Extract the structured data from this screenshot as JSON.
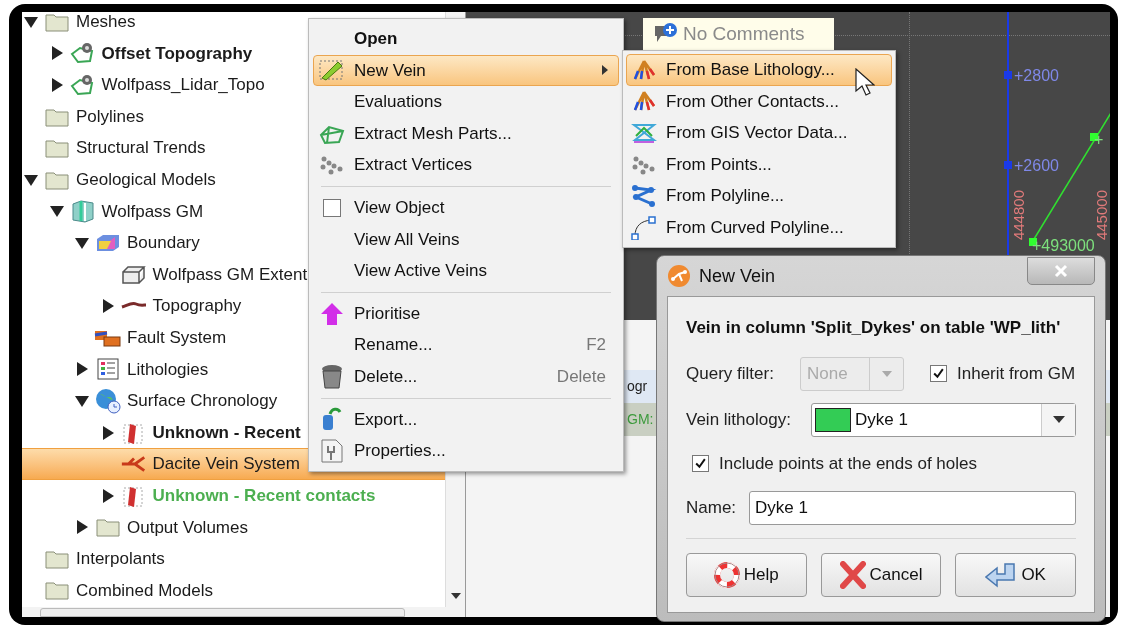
{
  "tree": [
    {
      "label": "Meshes",
      "kind": "folder",
      "expanded": true,
      "selected": false,
      "children": [
        {
          "label": "Offset Topography",
          "kind": "mesh",
          "bold": true,
          "expanded": false,
          "selected": false
        },
        {
          "label": "Wolfpass_Lidar_Topo",
          "kind": "mesh",
          "expanded": false,
          "selected": false
        }
      ]
    },
    {
      "label": "Polylines",
      "kind": "folder",
      "selected": false
    },
    {
      "label": "Structural Trends",
      "kind": "folder",
      "selected": false
    },
    {
      "label": "Geological Models",
      "kind": "folder",
      "expanded": true,
      "selected": false,
      "children": [
        {
          "label": "Wolfpass GM",
          "kind": "model",
          "expanded": true,
          "selected": false,
          "children": [
            {
              "label": "Boundary",
              "kind": "boundary",
              "expanded": true,
              "selected": false,
              "children": [
                {
                  "label": "Wolfpass GM Extent",
                  "kind": "box",
                  "selected": false
                },
                {
                  "label": "Topography",
                  "kind": "surface",
                  "expanded": false,
                  "selected": false
                }
              ]
            },
            {
              "label": "Fault System",
              "kind": "fault",
              "selected": false
            },
            {
              "label": "Lithologies",
              "kind": "lithologies",
              "expanded": false,
              "selected": false
            },
            {
              "label": "Surface Chronology",
              "kind": "chronology",
              "expanded": true,
              "selected": false,
              "children": [
                {
                  "label": "Unknown - Recent",
                  "kind": "contacts",
                  "bold": true,
                  "expanded": false,
                  "selected": false
                },
                {
                  "label": "Dacite Vein System",
                  "kind": "vein",
                  "selected": true
                },
                {
                  "label": "Unknown - Recent contacts",
                  "kind": "contacts",
                  "bold": true,
                  "color": "#4caf50",
                  "expanded": false,
                  "selected": false
                }
              ]
            },
            {
              "label": "Output Volumes",
              "kind": "folder",
              "expanded": false,
              "selected": false
            }
          ]
        }
      ]
    },
    {
      "label": "Interpolants",
      "kind": "folder",
      "selected": false
    },
    {
      "label": "Combined Models",
      "kind": "folder",
      "selected": false
    }
  ],
  "side_panel": {
    "rows": [
      {
        "text": "ogr"
      },
      {
        "text": "GM:"
      }
    ]
  },
  "viewport": {
    "comment_tag": "No Comments",
    "labels": [
      {
        "text": "+2800",
        "kind": "elevation"
      },
      {
        "text": "+2600",
        "kind": "elevation"
      },
      {
        "text": "+",
        "kind": "northing"
      },
      {
        "text": "+493000",
        "kind": "northing"
      },
      {
        "text": "444800",
        "kind": "easting"
      },
      {
        "text": "445000",
        "kind": "easting"
      }
    ]
  },
  "context_menu": {
    "items": [
      {
        "kind": "item",
        "label": "Open",
        "bold": true,
        "selected": false
      },
      {
        "kind": "item",
        "label": "New Vein",
        "has_submenu": true,
        "selected": true
      },
      {
        "kind": "item",
        "label": "Evaluations",
        "selected": false
      },
      {
        "kind": "item",
        "label": "Extract Mesh Parts...",
        "selected": false
      },
      {
        "kind": "item",
        "label": "Extract Vertices",
        "selected": false
      },
      {
        "kind": "separator"
      },
      {
        "kind": "checkbox",
        "label": "View Object",
        "checked": false,
        "selected": false
      },
      {
        "kind": "item",
        "label": "View All Veins",
        "selected": false
      },
      {
        "kind": "item",
        "label": "View Active Veins",
        "selected": false
      },
      {
        "kind": "separator"
      },
      {
        "kind": "item",
        "label": "Prioritise",
        "selected": false
      },
      {
        "kind": "item",
        "label": "Rename...",
        "shortcut": "F2",
        "selected": false
      },
      {
        "kind": "item",
        "label": "Delete...",
        "shortcut": "Delete",
        "selected": false
      },
      {
        "kind": "separator"
      },
      {
        "kind": "item",
        "label": "Export...",
        "selected": false
      },
      {
        "kind": "item",
        "label": "Properties...",
        "selected": false
      }
    ]
  },
  "submenu": {
    "items": [
      {
        "label": "From Base Lithology...",
        "selected": true
      },
      {
        "label": "From Other Contacts...",
        "selected": false
      },
      {
        "label": "From GIS Vector Data...",
        "selected": false
      },
      {
        "label": "From Points...",
        "selected": false
      },
      {
        "label": "From Polyline...",
        "selected": false
      },
      {
        "label": "From Curved Polyline...",
        "selected": false
      }
    ]
  },
  "dialog": {
    "title": "New Vein",
    "heading": "Vein in column 'Split_Dykes' on table 'WP_lith'",
    "query_filter": {
      "label": "Query filter:",
      "value": "None",
      "disabled": true
    },
    "inherit": {
      "label": "Inherit from GM",
      "checked": true
    },
    "lithology": {
      "label": "Vein lithology:",
      "value": "Dyke 1",
      "color": "#33cc55"
    },
    "include_ends": {
      "label": "Include points at the ends of holes",
      "checked": true
    },
    "name": {
      "label": "Name:",
      "value": "Dyke 1"
    },
    "buttons": [
      {
        "label": "Help",
        "kind": "help"
      },
      {
        "label": "Cancel",
        "kind": "cancel"
      },
      {
        "label": "OK",
        "kind": "ok"
      }
    ]
  }
}
